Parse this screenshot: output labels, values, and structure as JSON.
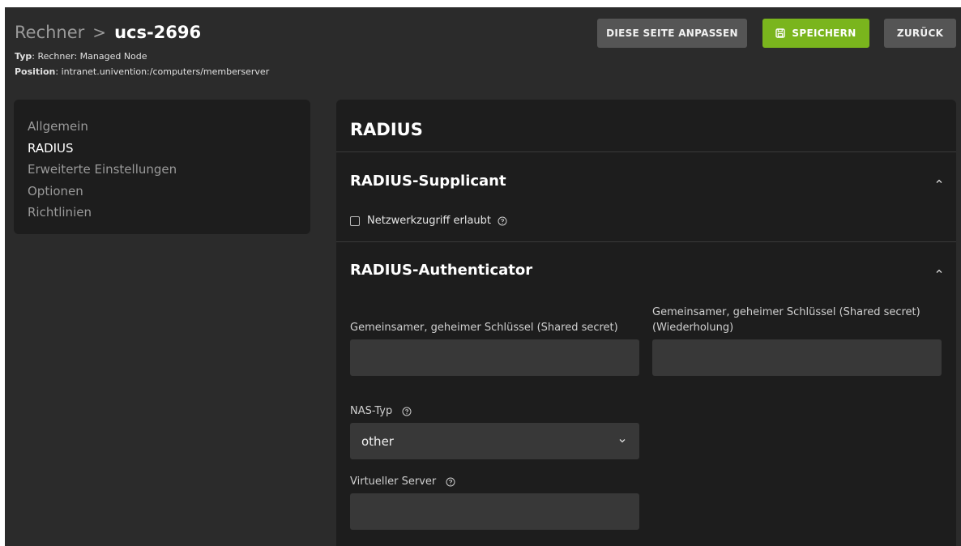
{
  "header": {
    "breadcrumb_parent": "Rechner",
    "breadcrumb_separator": ">",
    "breadcrumb_current": "ucs-2696",
    "type_key": "Typ",
    "type_value": "Rechner: Managed Node",
    "position_key": "Position",
    "position_value": "intranet.univention:/computers/memberserver"
  },
  "toolbar": {
    "customize_label": "DIESE SEITE ANPASSEN",
    "save_label": "SPEICHERN",
    "back_label": "ZURÜCK"
  },
  "nav": {
    "items": [
      {
        "label": "Allgemein",
        "active": false
      },
      {
        "label": "RADIUS",
        "active": true
      },
      {
        "label": "Erweiterte Einstellungen",
        "active": false
      },
      {
        "label": "Optionen",
        "active": false
      },
      {
        "label": "Richtlinien",
        "active": false
      }
    ]
  },
  "main": {
    "title": "RADIUS",
    "supplicant": {
      "title": "RADIUS-Supplicant",
      "checkbox_label": "Netzwerkzugriff erlaubt",
      "checked": false
    },
    "authenticator": {
      "title": "RADIUS-Authenticator",
      "secret_label": "Gemeinsamer, geheimer Schlüssel (Shared secret)",
      "secret_value": "",
      "secret_repeat_label_line1": "Gemeinsamer, geheimer Schlüssel (Shared secret)",
      "secret_repeat_label_line2": "(Wiederholung)",
      "secret_repeat_value": "",
      "nas_type_label": "NAS-Typ",
      "nas_type_value": "other",
      "virtual_server_label": "Virtueller Server",
      "virtual_server_value": ""
    }
  },
  "colors": {
    "background": "#2b2b2b",
    "panel": "#1d1d1d",
    "input": "#383838",
    "save_button": "#7ab51d",
    "secondary_button": "#555555"
  }
}
